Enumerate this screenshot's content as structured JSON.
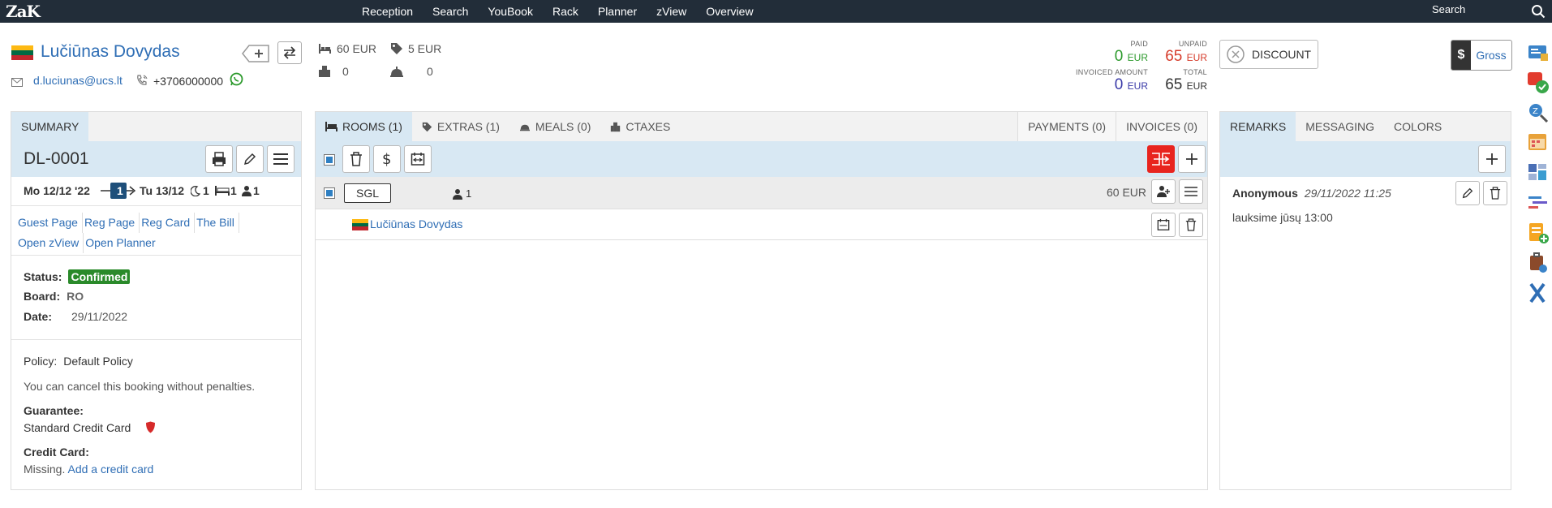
{
  "nav": {
    "logo": "ZaK",
    "items": [
      "Reception",
      "Search",
      "YouBook",
      "Rack",
      "Planner",
      "zView",
      "Overview"
    ],
    "search_label": "Search"
  },
  "guest": {
    "name": "Lučiūnas Dovydas",
    "email": "d.luciunas@ucs.lt",
    "phone": "+3706000000"
  },
  "stats": {
    "room_price": "60 EUR",
    "extras_price": "5 EUR",
    "city_tax": "0",
    "service": "0"
  },
  "finance": {
    "paid_label": "PAID",
    "paid_value": "0",
    "paid_currency": "EUR",
    "unpaid_label": "UNPAID",
    "unpaid_value": "65",
    "unpaid_currency": "EUR",
    "invoiced_label": "INVOICED AMOUNT",
    "invoiced_value": "0",
    "invoiced_currency": "EUR",
    "total_label": "TOTAL",
    "total_value": "65",
    "total_currency": "EUR"
  },
  "discount_label": "DISCOUNT",
  "gross": {
    "symbol": "$",
    "label": "Gross"
  },
  "summary": {
    "tab": "SUMMARY",
    "code": "DL-0001",
    "checkin": "Mo 12/12 '22",
    "nights_badge": "1",
    "checkout": "Tu 13/12",
    "nights": "1",
    "rooms": "1",
    "guests": "1",
    "links": [
      "Guest Page",
      "Reg Page",
      "Reg Card",
      "The Bill",
      "Open zView",
      "Open Planner"
    ],
    "status_label": "Status:",
    "status_value": "Confirmed",
    "board_label": "Board:",
    "board_value": "RO",
    "date_label": "Date:",
    "date_value": "29/11/2022",
    "policy_label": "Policy:",
    "policy_value": "Default Policy",
    "policy_text": "You can cancel this booking without penalties.",
    "guarantee_label": "Guarantee:",
    "guarantee_value": "Standard Credit Card",
    "cc_label": "Credit Card:",
    "cc_missing": "Missing.",
    "cc_link": "Add a credit card"
  },
  "rooms": {
    "tabs": [
      "ROOMS (1)",
      "EXTRAS (1)",
      "MEALS (0)",
      "CTAXES"
    ],
    "right_tabs": [
      "PAYMENTS (0)",
      "INVOICES (0)"
    ],
    "room_type": "SGL",
    "room_guests": "1",
    "room_price": "60 EUR",
    "guest_name": "Lučiūnas Dovydas"
  },
  "remarks": {
    "tabs": [
      "REMARKS",
      "MESSAGING",
      "COLORS"
    ],
    "author": "Anonymous",
    "date": "29/11/2022 11:25",
    "text": "lauksime jūsų 13:00"
  }
}
